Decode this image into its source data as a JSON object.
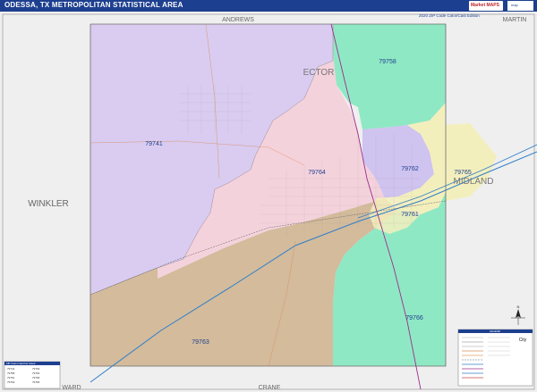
{
  "header": {
    "title": "ODESSA, TX METROPOLITAN STATISTICAL AREA",
    "edition": "2020 ZIP Code Color/Cast Edition",
    "logo_text": "Market MAPS",
    "corner_text": "map"
  },
  "counties": {
    "andrews": "ANDREWS",
    "martin": "MARTIN",
    "ector": "ECTOR",
    "midland": "MIDLAND",
    "winkler": "WINKLER",
    "crane": "CRANE",
    "ward": "WARD"
  },
  "zips": {
    "z79741": "79741",
    "z79758": "79758",
    "z79764": "79764",
    "z79762": "79762",
    "z79765": "79765",
    "z79761": "79761",
    "z79763": "79763",
    "z79766": "79766"
  },
  "legend": {
    "title": "LEGEND",
    "city_label": "City",
    "north_label": "N"
  },
  "zip_list": {
    "title": "ZIP Code Index/Ind Listed",
    "rows": [
      "79741",
      "79758",
      "79761",
      "79762",
      "79763",
      "79764",
      "79765",
      "79766"
    ]
  },
  "colors": {
    "purple": "#d9ccf0",
    "pink": "#f4d2dc",
    "tan": "#d3bb9c",
    "green": "#8fe8c4",
    "yellow": "#f3efbd",
    "lilac": "#cfc3f0",
    "outside": "#efefef",
    "header": "#1d3f8f"
  }
}
